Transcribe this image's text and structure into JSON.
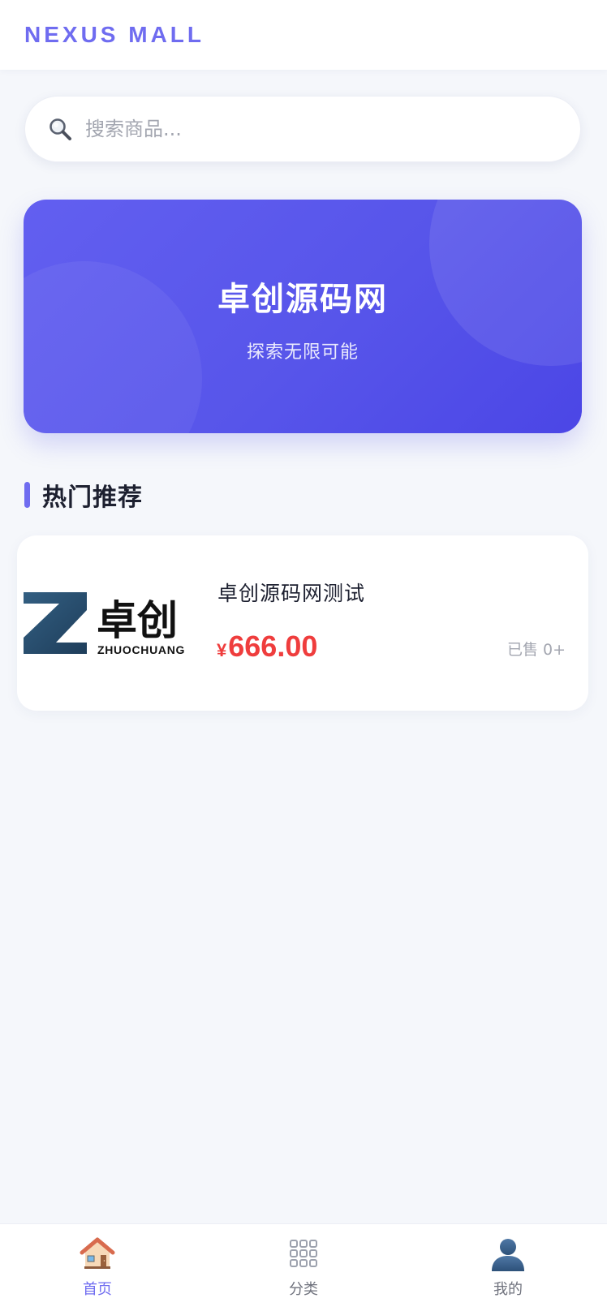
{
  "header": {
    "brand": "NEXUS MALL"
  },
  "search": {
    "placeholder": "搜索商品..."
  },
  "banner": {
    "title": "卓创源码网",
    "subtitle": "探索无限可能"
  },
  "section": {
    "title": "热门推荐"
  },
  "products": [
    {
      "logo_text": "卓创",
      "logo_subtext": "ZHUOCHUANG",
      "name": "卓创源码网测试",
      "currency": "¥",
      "price": "666.00",
      "sold": "已售 0+"
    }
  ],
  "bottom_nav": [
    {
      "label": "首页",
      "icon": "home-icon",
      "active": true
    },
    {
      "label": "分类",
      "icon": "grid-icon",
      "active": false
    },
    {
      "label": "我的",
      "icon": "user-icon",
      "active": false
    }
  ],
  "colors": {
    "accent": "#6f6cf0",
    "banner_start": "#625ff0",
    "banner_end": "#4b46e6",
    "price": "#ef3d3d"
  }
}
